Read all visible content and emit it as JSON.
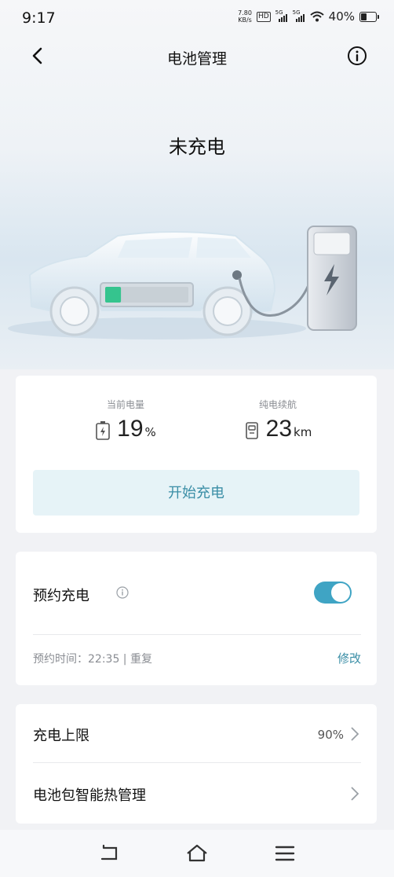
{
  "status_bar": {
    "time": "9:17",
    "speed_value": "7.80",
    "speed_unit": "KB/s",
    "hd": "HD",
    "sim1": "5G",
    "sim2": "5G",
    "battery_percent": "40%",
    "battery_level": 0.4
  },
  "nav": {
    "title": "电池管理",
    "back_icon": "chevron-left-icon",
    "info_icon": "info-icon"
  },
  "hero": {
    "status": "未充电",
    "accent_color": "#3fa4c4",
    "battery_fill_color": "#35c48e"
  },
  "stats": {
    "battery": {
      "label": "当前电量",
      "value": "19",
      "unit": "%"
    },
    "range": {
      "label": "纯电续航",
      "value": "23",
      "unit": "km"
    }
  },
  "charge_button": {
    "label": "开始充电"
  },
  "schedule": {
    "title": "预约充电",
    "enabled": true,
    "time_label": "预约时间：22:35 | 重复",
    "edit_label": "修改"
  },
  "settings": {
    "items": [
      {
        "label": "充电上限",
        "value": "90%"
      },
      {
        "label": "电池包智能热管理",
        "value": ""
      }
    ]
  },
  "system_nav": {
    "back_icon": "back-icon",
    "home_icon": "home-icon",
    "menu_icon": "menu-icon"
  }
}
